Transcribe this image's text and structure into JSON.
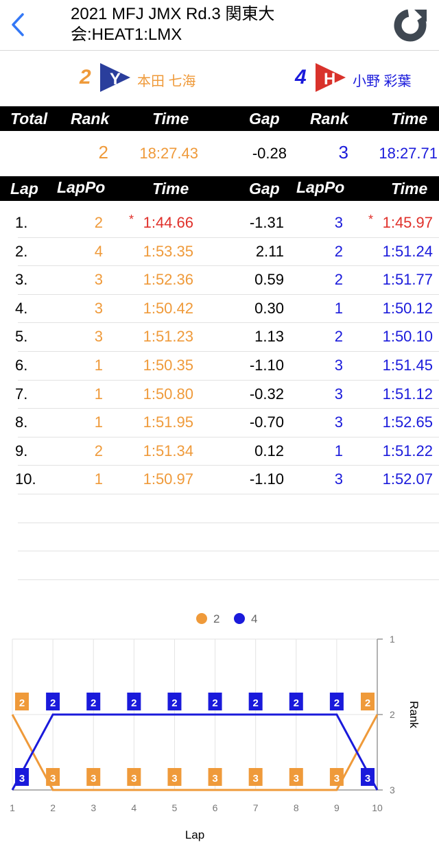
{
  "header": {
    "back_icon": "chevron-left-icon",
    "title_line1": "2021 MFJ JMX Rd.3 関東大",
    "title_line2": "会:HEAT1:LMX",
    "refresh_icon": "refresh-icon"
  },
  "riders": [
    {
      "bib": "2",
      "badge": "Y",
      "name": "本田 七海",
      "color": "#ef9a3a",
      "badge_color": "#2a3e9c"
    },
    {
      "bib": "4",
      "badge": "H",
      "name": "小野 彩葉",
      "color": "#1a1adb",
      "badge_color": "#d9322b"
    }
  ],
  "total_header": {
    "c1": "Total",
    "c2": "Rank",
    "c3": "Time",
    "c4": "Gap",
    "c5": "Rank",
    "c6": "Time"
  },
  "total_row": {
    "rank1": "2",
    "time1": "18:27.43",
    "gap": "-0.28",
    "rank2": "3",
    "time2": "18:27.71"
  },
  "lap_header": {
    "c1": "Lap",
    "c2": "LapPo",
    "c3": "Time",
    "c4": "Gap",
    "c5": "LapPo",
    "c6": "Time"
  },
  "laps": [
    {
      "lap": "1.",
      "po1": "2",
      "best1": "*",
      "time1": "1:44.66",
      "gap": "-1.31",
      "po2": "3",
      "best2": "*",
      "time2": "1:45.97"
    },
    {
      "lap": "2.",
      "po1": "4",
      "best1": "",
      "time1": "1:53.35",
      "gap": "2.11",
      "po2": "2",
      "best2": "",
      "time2": "1:51.24"
    },
    {
      "lap": "3.",
      "po1": "3",
      "best1": "",
      "time1": "1:52.36",
      "gap": "0.59",
      "po2": "2",
      "best2": "",
      "time2": "1:51.77"
    },
    {
      "lap": "4.",
      "po1": "3",
      "best1": "",
      "time1": "1:50.42",
      "gap": "0.30",
      "po2": "1",
      "best2": "",
      "time2": "1:50.12"
    },
    {
      "lap": "5.",
      "po1": "3",
      "best1": "",
      "time1": "1:51.23",
      "gap": "1.13",
      "po2": "2",
      "best2": "",
      "time2": "1:50.10"
    },
    {
      "lap": "6.",
      "po1": "1",
      "best1": "",
      "time1": "1:50.35",
      "gap": "-1.10",
      "po2": "3",
      "best2": "",
      "time2": "1:51.45"
    },
    {
      "lap": "7.",
      "po1": "1",
      "best1": "",
      "time1": "1:50.80",
      "gap": "-0.32",
      "po2": "3",
      "best2": "",
      "time2": "1:51.12"
    },
    {
      "lap": "8.",
      "po1": "1",
      "best1": "",
      "time1": "1:51.95",
      "gap": "-0.70",
      "po2": "3",
      "best2": "",
      "time2": "1:52.65"
    },
    {
      "lap": "9.",
      "po1": "2",
      "best1": "",
      "time1": "1:51.34",
      "gap": "0.12",
      "po2": "1",
      "best2": "",
      "time2": "1:51.22"
    },
    {
      "lap": "10.",
      "po1": "1",
      "best1": "",
      "time1": "1:50.97",
      "gap": "-1.10",
      "po2": "3",
      "best2": "",
      "time2": "1:52.07"
    }
  ],
  "chart_data": {
    "type": "line",
    "x": [
      1,
      2,
      3,
      4,
      5,
      6,
      7,
      8,
      9,
      10
    ],
    "xlabel": "Lap",
    "ylabel": "Rank",
    "ylim": [
      3,
      1
    ],
    "yticks": [
      1,
      2,
      3
    ],
    "legend_position": "top-center",
    "grid": true,
    "series": [
      {
        "name": "2",
        "color": "#ef9a3a",
        "values": [
          2,
          3,
          3,
          3,
          3,
          3,
          3,
          3,
          3,
          2
        ]
      },
      {
        "name": "4",
        "color": "#1a1adb",
        "values": [
          3,
          2,
          2,
          2,
          2,
          2,
          2,
          2,
          2,
          3
        ]
      }
    ]
  }
}
